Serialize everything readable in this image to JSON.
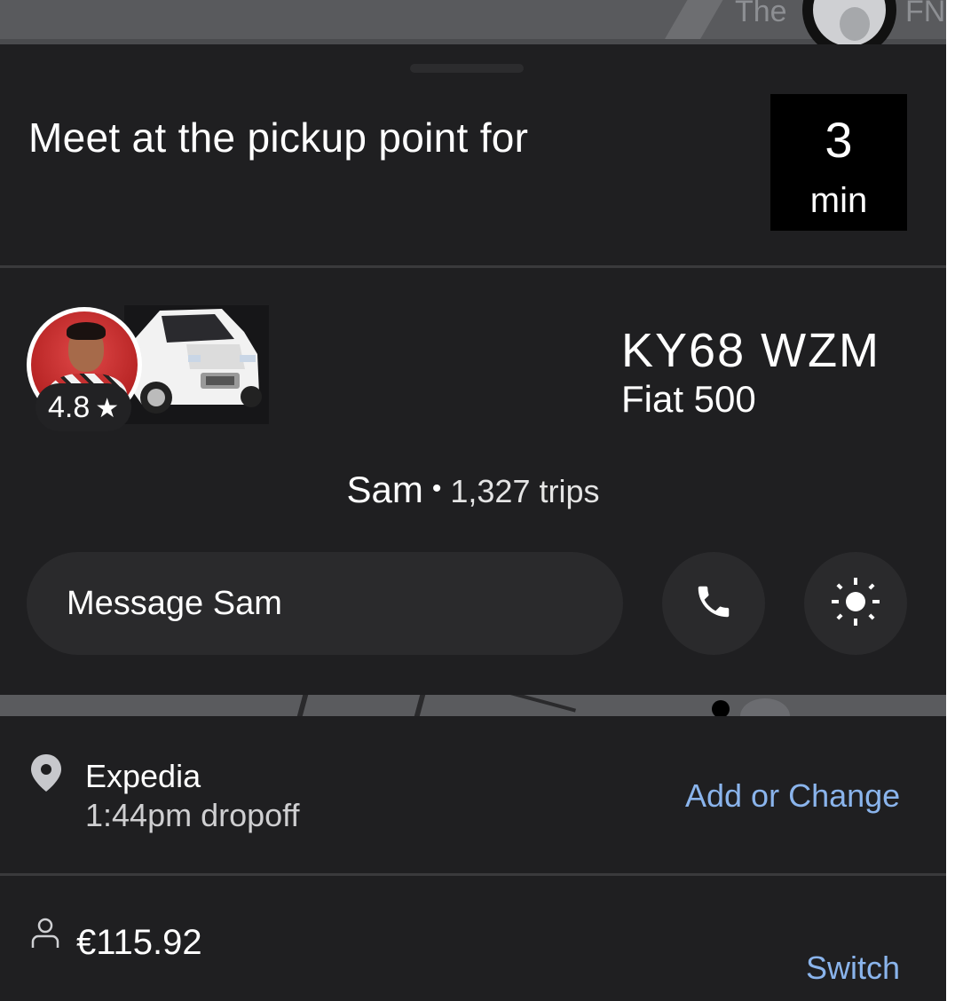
{
  "map": {
    "label_left": "The",
    "label_right": "FN"
  },
  "header": {
    "title": "Meet at the pickup point for",
    "eta_value": "3",
    "eta_unit": "min"
  },
  "driver": {
    "rating": "4.8",
    "star": "★",
    "plate": "KY68 WZM",
    "car_model": "Fiat 500",
    "name": "Sam",
    "separator": "•",
    "trips": "1,327 trips"
  },
  "actions": {
    "message_label": "Message Sam",
    "call_icon": "phone-icon",
    "more_icon": "sun-icon"
  },
  "destination": {
    "name": "Expedia",
    "dropoff": "1:44pm dropoff",
    "change_label": "Add or Change"
  },
  "payment": {
    "fare": "€115.92",
    "switch_label": "Switch"
  },
  "colors": {
    "sheet": "#1f1f21",
    "link": "#8ab4ec",
    "eta_bg": "#000000"
  }
}
